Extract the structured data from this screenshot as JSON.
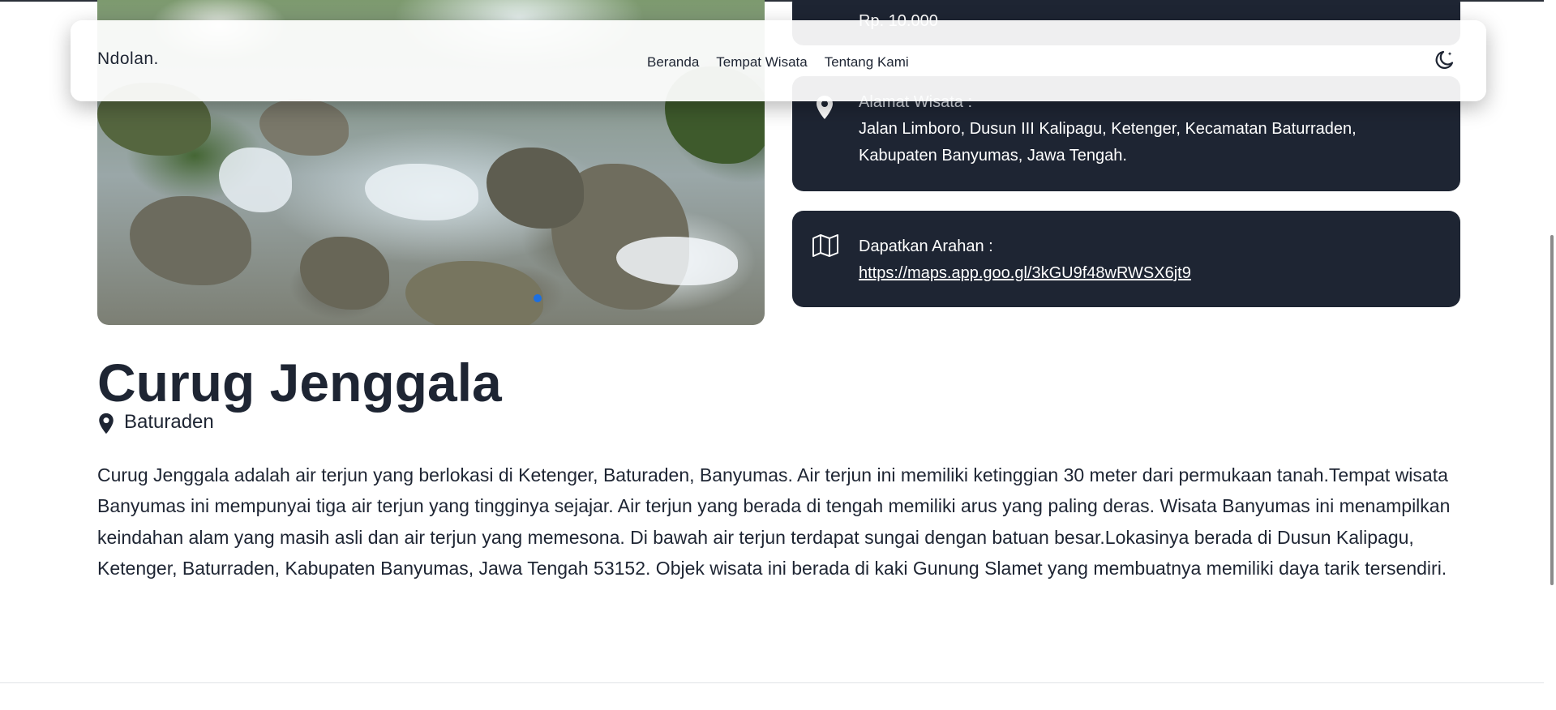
{
  "navbar": {
    "brand": "Ndolan.",
    "links": [
      "Beranda",
      "Tempat Wisata",
      "Tentang Kami"
    ],
    "theme_toggle_icon": "moon-icon"
  },
  "gallery": {
    "image_alt": "waterfall-photo",
    "slide_count": 1,
    "active_slide": 1,
    "indicator_color": "#1d6fe0"
  },
  "info_cards": {
    "price": {
      "value": "Rp. 10.000"
    },
    "address": {
      "icon": "map-pin-icon",
      "label": "Alamat Wisata :",
      "line1": "Jalan Limboro, Dusun III Kalipagu, Ketenger, Kecamatan Baturraden,",
      "line2": "Kabupaten Banyumas, Jawa Tengah."
    },
    "directions": {
      "icon": "map-icon",
      "label": "Dapatkan Arahan :",
      "link_text": "https://maps.app.goo.gl/3kGU9f48wRWSX6jt9"
    }
  },
  "place": {
    "title": "Curug Jenggala",
    "location": "Baturaden",
    "description": "Curug Jenggala adalah air terjun yang berlokasi di Ketenger, Baturaden, Banyumas. Air terjun ini memiliki ketinggian 30 meter dari permukaan tanah.Tempat wisata Banyumas ini mempunyai tiga air terjun yang tingginya sejajar. Air terjun yang berada di tengah memiliki arus yang paling deras. Wisata Banyumas ini menampilkan keindahan alam yang masih asli dan air terjun yang memesona. Di bawah air terjun terdapat sungai dengan batuan besar.Lokasinya berada di Dusun Kalipagu, Ketenger, Baturraden, Kabupaten Banyumas, Jawa Tengah 53152. Objek wisata ini berada di kaki Gunung Slamet yang membuatnya memiliki daya tarik tersendiri."
  },
  "colors": {
    "card_bg": "#1e2533",
    "text": "#1e2533",
    "accent": "#1d6fe0"
  }
}
